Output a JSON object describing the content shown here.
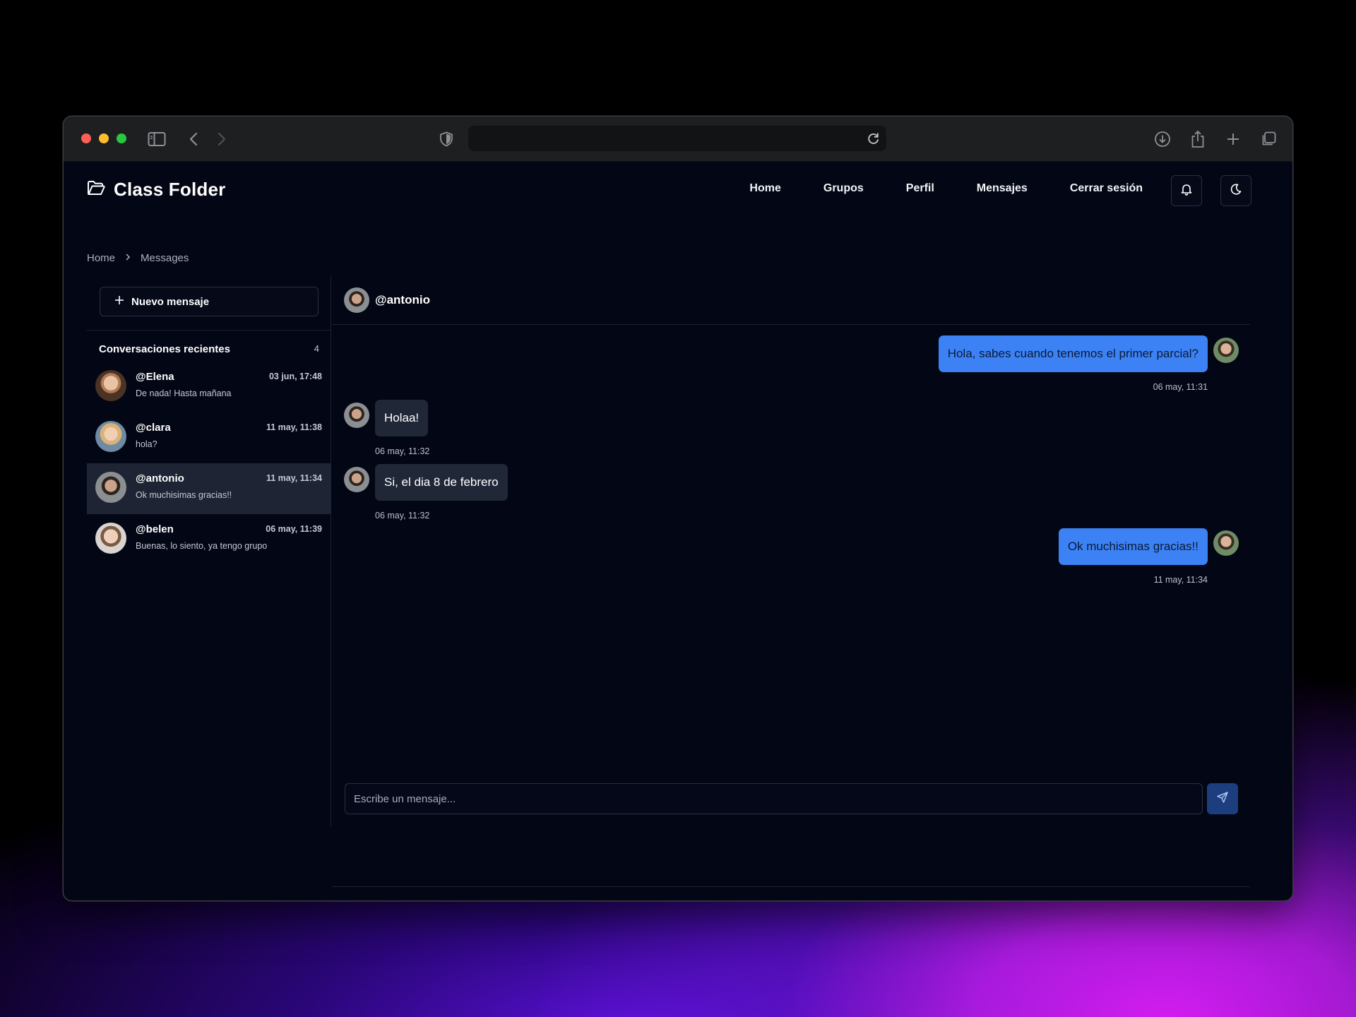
{
  "browser": {
    "url": "",
    "icons": [
      "sidebar-icon",
      "back-icon",
      "forward-icon",
      "shield-icon",
      "reload-icon",
      "download-icon",
      "share-icon",
      "new-tab-icon",
      "tabs-overview-icon"
    ]
  },
  "app": {
    "brand": "Class Folder",
    "brand_icon": "folder-icon",
    "nav": [
      "Home",
      "Grupos",
      "Perfil",
      "Mensajes",
      "Cerrar sesión"
    ],
    "nav_icons": [
      "bell-icon",
      "moon-icon"
    ]
  },
  "breadcrumb": [
    "Home",
    "Messages"
  ],
  "sidebar": {
    "new_message_label": "Nuevo mensaje",
    "section_title": "Conversaciones recientes",
    "count": "4",
    "conversations": [
      {
        "name": "@Elena",
        "time": "03 jun, 17:48",
        "preview": "De nada! Hasta mañana",
        "active": false
      },
      {
        "name": "@clara",
        "time": "11 may, 11:38",
        "preview": "hola?",
        "active": false
      },
      {
        "name": "@antonio",
        "time": "11 may, 11:34",
        "preview": "Ok muchisimas gracias!!",
        "active": true
      },
      {
        "name": "@belen",
        "time": "06 may, 11:39",
        "preview": "Buenas, lo siento, ya tengo grupo",
        "active": false
      }
    ]
  },
  "chat": {
    "username": "@antonio",
    "messages": [
      {
        "from": "me",
        "text": "Hola, sabes cuando tenemos el primer parcial?",
        "time": "06 may, 11:31"
      },
      {
        "from": "them",
        "text": "Holaa!",
        "time": "06 may, 11:32"
      },
      {
        "from": "them",
        "text": "Si, el dia 8 de febrero",
        "time": "06 may, 11:32"
      },
      {
        "from": "me",
        "text": "Ok muchisimas gracias!!",
        "time": "11 may, 11:34"
      }
    ],
    "composer_placeholder": "Escribe un mensaje...",
    "send_icon": "send-icon"
  },
  "colors": {
    "page_bg": "#030614",
    "my_bubble": "#3c82f4",
    "their_bubble": "#202737",
    "active_conversation": "#1e2434",
    "send_button": "#1d3e7e"
  }
}
